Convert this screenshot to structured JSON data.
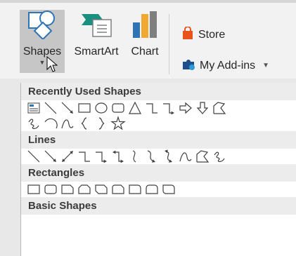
{
  "ribbon": {
    "shapes_label": "Shapes",
    "smartart_label": "SmartArt",
    "chart_label": "Chart",
    "store_label": "Store",
    "addins_label": "My Add-ins",
    "colors": {
      "store": "#e8521c",
      "addins": "#1f4e8c",
      "accent": "#2e75b6",
      "smartart": "#1b8f80"
    }
  },
  "gallery": {
    "recent_header": "Recently Used Shapes",
    "lines_header": "Lines",
    "rect_header": "Rectangles",
    "basic_header": "Basic Shapes",
    "recent_row1": [
      "text-box-icon",
      "line-icon",
      "arrow-line-icon",
      "rectangle-icon",
      "oval-icon",
      "rounded-rectangle-icon",
      "triangle-icon",
      "elbow-connector-icon",
      "elbow-arrow-connector-icon",
      "right-arrow-icon",
      "down-arrow-icon",
      "freeform-icon"
    ],
    "recent_row2": [
      "scribble-icon",
      "arc-icon",
      "curve-icon",
      "left-brace-icon",
      "right-brace-icon",
      "star-icon"
    ],
    "lines_row": [
      "line-icon",
      "arrow-line-icon",
      "double-arrow-line-icon",
      "elbow-connector-icon",
      "elbow-arrow-connector-icon",
      "elbow-double-arrow-connector-icon",
      "curved-connector-icon",
      "curved-arrow-connector-icon",
      "curved-double-arrow-connector-icon",
      "curve-icon",
      "freeform-icon",
      "scribble-icon"
    ],
    "rect_row": [
      "rectangle-icon",
      "rounded-rectangle-icon",
      "snip-single-corner-rectangle-icon",
      "snip-same-side-rectangle-icon",
      "snip-diagonal-rectangle-icon",
      "snip-round-rectangle-icon",
      "round-single-corner-rectangle-icon",
      "round-same-side-rectangle-icon",
      "round-diagonal-rectangle-icon"
    ]
  }
}
